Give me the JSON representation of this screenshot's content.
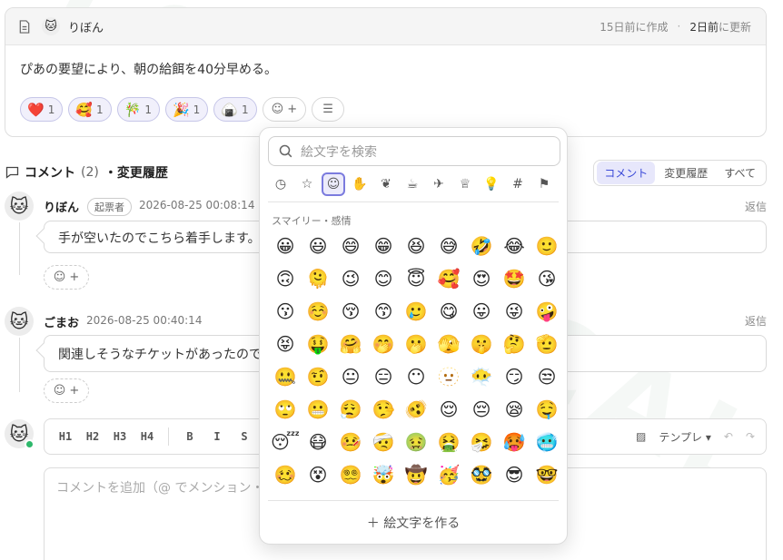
{
  "ticket": {
    "author": "りぼん",
    "created": "15日前に作成",
    "updated_bold": "2日前",
    "updated_suffix": "に更新",
    "body": "ぴあの要望により、朝の給餌を40分早める。",
    "reactions": [
      {
        "emoji": "❤️",
        "count": "1"
      },
      {
        "emoji": "🥰",
        "count": "1"
      },
      {
        "emoji": "🎋",
        "count": "1"
      },
      {
        "emoji": "🎉",
        "count": "1"
      },
      {
        "emoji": "🍙",
        "count": "1"
      }
    ],
    "add_label": "+"
  },
  "comments_section": {
    "title": "コメント",
    "count": "(2)",
    "suffix": "・変更履歴",
    "tabs": [
      "コメント",
      "変更履歴",
      "すべて"
    ],
    "active_tab": "コメント"
  },
  "comments": [
    {
      "author": "りぼん",
      "badge": "起票者",
      "date": "2026-08-25 00:08:14",
      "reply": "返信",
      "text": "手が空いたのでこちら着手します。",
      "avatar": "🐱"
    },
    {
      "author": "ごまお",
      "date": "2026-08-25 00:40:14",
      "reply": "返信",
      "text": "関連しそうなチケットがあったので",
      "avatar": "🐱"
    }
  ],
  "editor": {
    "toolbar": [
      "H1",
      "H2",
      "H3",
      "H4",
      "B",
      "I",
      "S"
    ],
    "template_label": "テンプレ ▾",
    "placeholder": "コメントを追加（@ でメンション・"
  },
  "emoji_picker": {
    "search_placeholder": "絵文字を検索",
    "categories": [
      "recent-icon",
      "star-icon",
      "smiley-icon",
      "hand-icon",
      "leaf-icon",
      "cup-icon",
      "plane-icon",
      "trophy-icon",
      "bulb-icon",
      "hash-icon",
      "flag-icon"
    ],
    "active_category": "smiley-icon",
    "group_label": "スマイリー・感情",
    "emojis": [
      "😀",
      "😃",
      "😄",
      "😁",
      "😆",
      "😅",
      "🤣",
      "😂",
      "🙂",
      "🙃",
      "🫠",
      "😉",
      "😊",
      "😇",
      "🥰",
      "😍",
      "🤩",
      "😘",
      "😗",
      "☺️",
      "😚",
      "😙",
      "🥲",
      "😋",
      "😛",
      "😜",
      "🤪",
      "😝",
      "🤑",
      "🤗",
      "🤭",
      "🫢",
      "🫣",
      "🤫",
      "🤔",
      "🫡",
      "🤐",
      "🤨",
      "😐",
      "😑",
      "😶",
      "🫥",
      "😶‍🌫️",
      "😏",
      "😒",
      "🙄",
      "😬",
      "😮‍💨",
      "🤥",
      "🫨",
      "😌",
      "😔",
      "😪",
      "🤤",
      "😴",
      "😷",
      "🤒",
      "🤕",
      "🤢",
      "🤮",
      "🤧",
      "🥵",
      "🥶",
      "🥴",
      "😵",
      "😵‍💫",
      "🤯",
      "🤠",
      "🥳",
      "🥸",
      "😎",
      "🤓"
    ],
    "create_label": "＋  絵文字を作る"
  },
  "colors": {
    "accent": "#3b4ad8",
    "online": "#2eb86b"
  }
}
